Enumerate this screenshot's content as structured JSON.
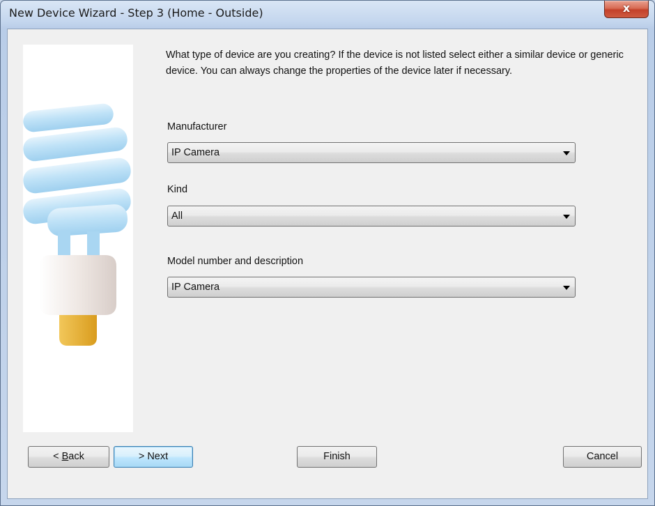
{
  "window": {
    "title": "New Device Wizard - Step 3 (Home - Outside)",
    "close_label": "x"
  },
  "intro": {
    "text": "What type of device are you creating?  If the device is not listed select either a similar device or generic device.  You can always change the properties of the device later if necessary."
  },
  "fields": {
    "manufacturer": {
      "label": "Manufacturer",
      "value": "IP Camera"
    },
    "kind": {
      "label": "Kind",
      "value": "All"
    },
    "model": {
      "label": "Model number and description",
      "value": "IP Camera"
    }
  },
  "buttons": {
    "back_prefix": "< ",
    "back_mnemonic": "B",
    "back_rest": "ack",
    "next": "> Next",
    "finish": "Finish",
    "cancel": "Cancel"
  },
  "icons": {
    "side_image": "cfl-light-bulb-icon",
    "close": "close-icon",
    "dropdown": "chevron-down-icon"
  },
  "colors": {
    "close_button": "#c3412a",
    "default_button_border": "#3c7fb1",
    "bulb_tube": "#bfe2f7",
    "bulb_base": "#e8b43a"
  }
}
